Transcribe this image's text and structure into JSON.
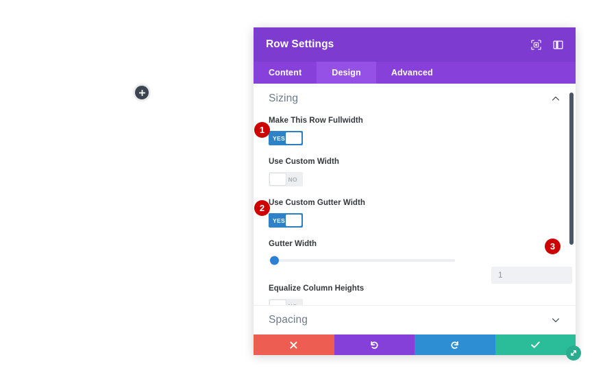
{
  "canvas": {
    "add_module_button": "add-module"
  },
  "modal": {
    "title": "Row Settings",
    "header_icons": [
      {
        "name": "responsive-preview-icon",
        "label": "Responsive View"
      },
      {
        "name": "panel-layout-icon",
        "label": "Panel Layout"
      }
    ],
    "tabs": [
      {
        "label": "Content",
        "active": false
      },
      {
        "label": "Design",
        "active": true
      },
      {
        "label": "Advanced",
        "active": false
      }
    ],
    "sections": {
      "sizing": {
        "title": "Sizing",
        "expanded": true,
        "toggle_icon": "chevron-up-icon",
        "fields": [
          {
            "type": "toggle",
            "label": "Make This Row Fullwidth",
            "value": "YES",
            "on": true
          },
          {
            "type": "toggle",
            "label": "Use Custom Width",
            "value": "NO",
            "on": false
          },
          {
            "type": "toggle",
            "label": "Use Custom Gutter Width",
            "value": "YES",
            "on": true
          },
          {
            "type": "slider",
            "label": "Gutter Width",
            "value": "1",
            "slider_position_pct": 0
          },
          {
            "type": "toggle",
            "label": "Equalize Column Heights",
            "value": "NO",
            "on": false
          }
        ]
      },
      "spacing": {
        "title": "Spacing",
        "expanded": false,
        "toggle_icon": "chevron-down-icon"
      }
    },
    "footer": {
      "cancel": {
        "name": "cancel-button",
        "icon": "close-x-icon"
      },
      "undo": {
        "name": "undo-button",
        "icon": "undo-arrow-icon"
      },
      "redo": {
        "name": "redo-button",
        "icon": "redo-arrow-icon"
      },
      "save": {
        "name": "save-button",
        "icon": "checkmark-icon"
      },
      "resize": {
        "name": "resize-handle",
        "icon": "diagonal-resize-icon"
      }
    },
    "scrollbar": {
      "name": "vertical-scrollbar"
    }
  },
  "callouts": [
    {
      "number": "1",
      "target": "Make This Row Fullwidth toggle"
    },
    {
      "number": "2",
      "target": "Use Custom Gutter Width toggle"
    },
    {
      "number": "3",
      "target": "Gutter Width value input"
    }
  ],
  "colors": {
    "header_purple": "#7e3bd0",
    "tabbar_purple": "#8740da",
    "tab_active_purple": "#9550e5",
    "toggle_on_blue": "#2d82c8",
    "slider_blue": "#2d7fd3",
    "cancel_red": "#ee5d52",
    "undo_purple": "#8540da",
    "redo_blue": "#2e8ed4",
    "save_green": "#2bbd9a",
    "badge_red": "#cc0000",
    "section_title_gray": "#6c7a89"
  }
}
